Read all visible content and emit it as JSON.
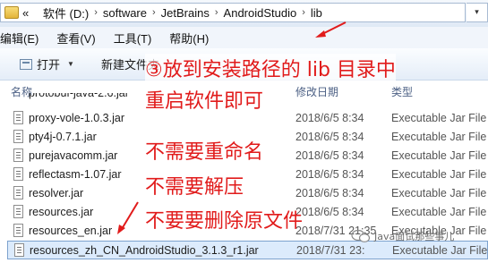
{
  "address_bar": {
    "back_label": "«",
    "segments": [
      "软件 (D:)",
      "software",
      "JetBrains",
      "AndroidStudio",
      "lib"
    ],
    "separator": "›",
    "dropdown_label": "▾"
  },
  "menu": [
    "编辑(E)",
    "查看(V)",
    "工具(T)",
    "帮助(H)"
  ],
  "toolbar": {
    "open_label": "打开",
    "open_dropdown": "▼",
    "new_folder_label": "新建文件夹"
  },
  "columns": {
    "name": "名称",
    "date": "修改日期",
    "type": "类型"
  },
  "files": [
    {
      "name": "proxy-vole-1.0.3.jar",
      "date": "2018/6/5 8:34",
      "type": "Executable Jar File"
    },
    {
      "name": "pty4j-0.7.1.jar",
      "date": "2018/6/5 8:34",
      "type": "Executable Jar File"
    },
    {
      "name": "purejavacomm.jar",
      "date": "2018/6/5 8:34",
      "type": "Executable Jar File"
    },
    {
      "name": "reflectasm-1.07.jar",
      "date": "2018/6/5 8:34",
      "type": "Executable Jar File"
    },
    {
      "name": "resolver.jar",
      "date": "2018/6/5 8:34",
      "type": "Executable Jar File"
    },
    {
      "name": "resources.jar",
      "date": "2018/6/5 8:34",
      "type": "Executable Jar File"
    },
    {
      "name": "resources_en.jar",
      "date": "2018/7/31 21:35",
      "type": "Executable Jar File"
    },
    {
      "name": "resources_zh_CN_AndroidStudio_3.1.3_r1.jar",
      "date": "2018/7/31 23:",
      "type": "Executable Jar File"
    }
  ],
  "annotations": {
    "step3_line1": "③放到安装路径的 lib 目录中",
    "step3_line2": "重启软件即可",
    "no_rename": "不需要重命名",
    "no_unzip": "不需要解压",
    "no_delete": "不要要删除原文件"
  },
  "watermark": "Java面试那些事儿",
  "colors": {
    "annotation": "#e11b1b",
    "selection_bg": "#dcebfc",
    "selection_border": "#7da2ce"
  }
}
